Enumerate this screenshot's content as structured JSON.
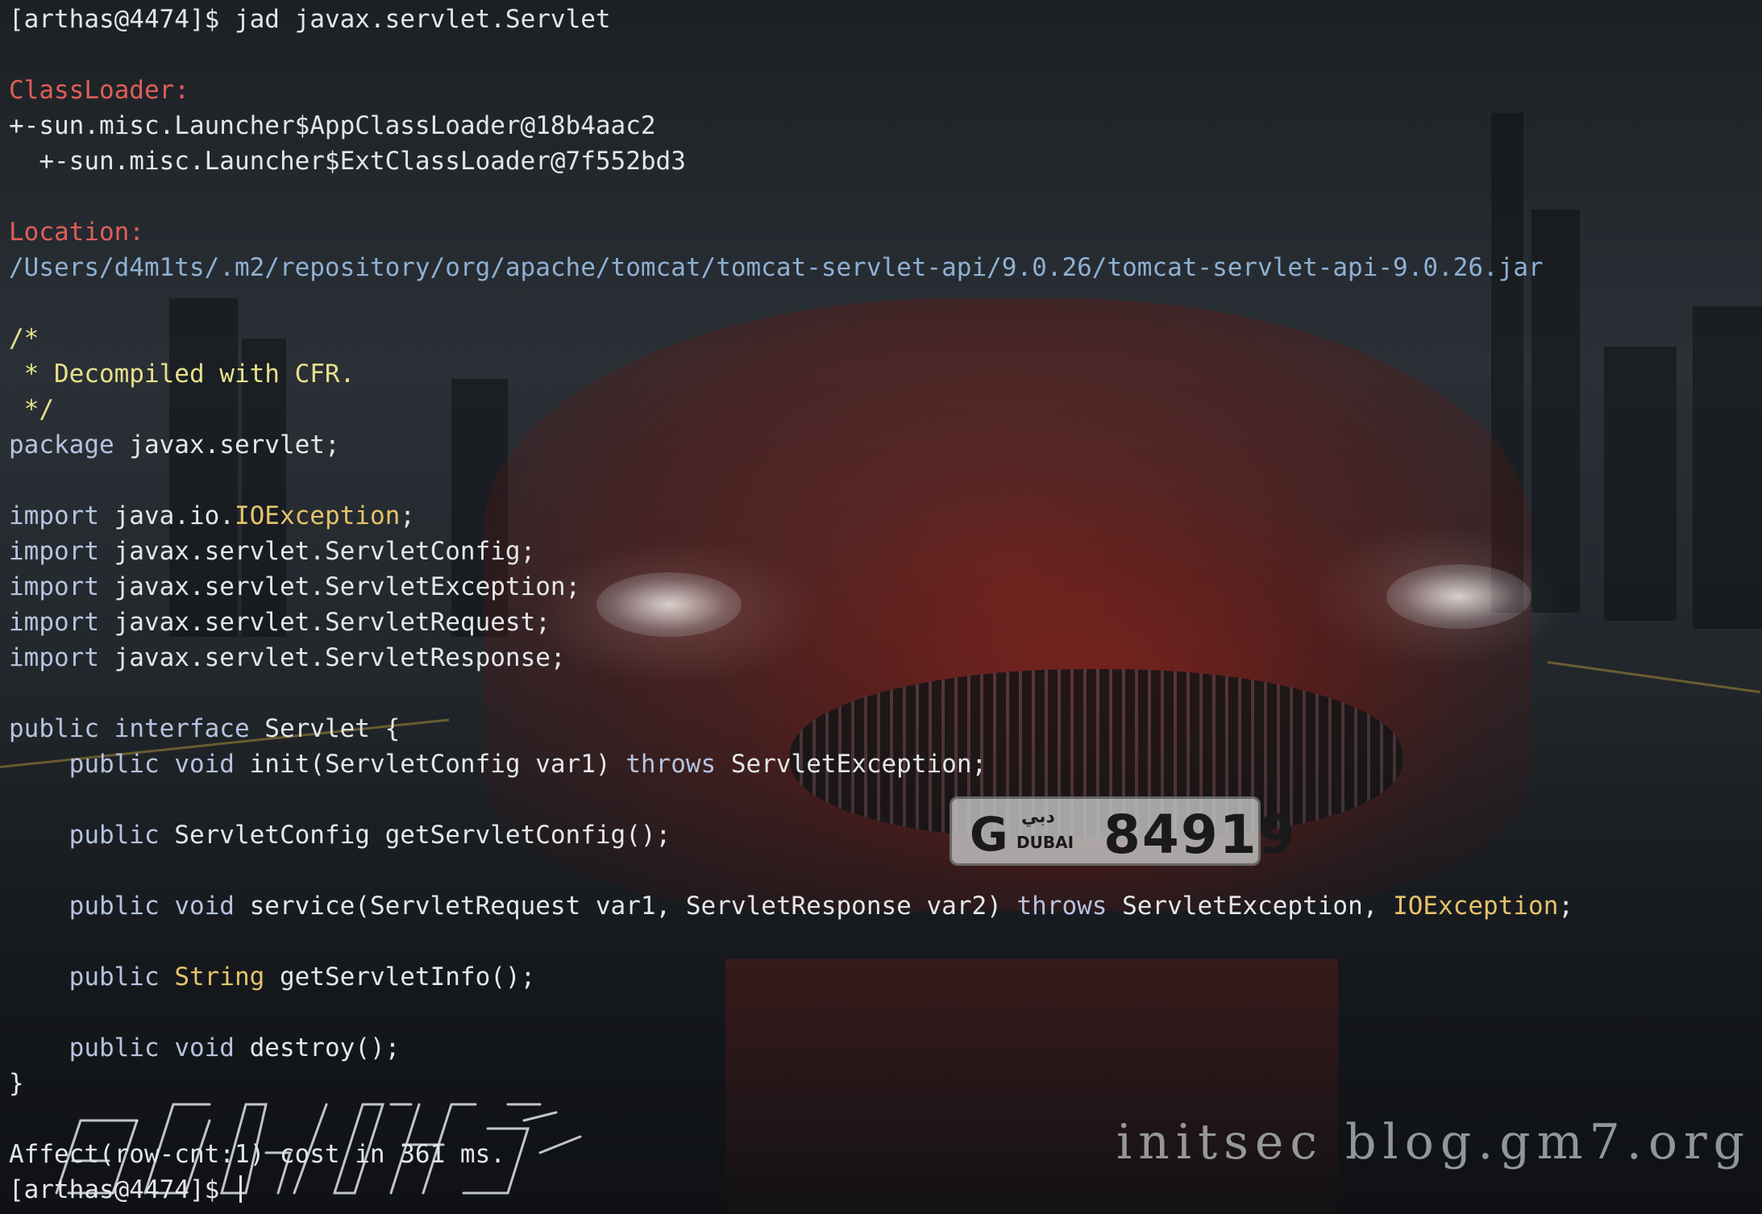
{
  "terminal": {
    "prompt": "[arthas@4474]$ ",
    "command": "jad javax.servlet.Servlet",
    "classloader_header": "ClassLoader:",
    "classloader_1": "+-sun.misc.Launcher$AppClassLoader@18b4aac2",
    "classloader_2": "  +-sun.misc.Launcher$ExtClassLoader@7f552bd3",
    "location_header": "Location:",
    "location_path": "/Users/d4m1ts/.m2/repository/org/apache/tomcat/tomcat-servlet-api/9.0.26/tomcat-servlet-api-9.0.26.jar",
    "code": {
      "comment_open": "/*",
      "comment_body": " * Decompiled with CFR.",
      "comment_close": " */",
      "kw_package": "package",
      "package_name": " javax.servlet;",
      "kw_import": "import",
      "import_1_prefix": " java.io.",
      "import_1_class": "IOException",
      "import_1_suffix": ";",
      "import_2": " javax.servlet.ServletConfig;",
      "import_3": " javax.servlet.ServletException;",
      "import_4": " javax.servlet.ServletRequest;",
      "import_5": " javax.servlet.ServletResponse;",
      "kw_public": "public",
      "kw_interface": "interface",
      "kw_void": "void",
      "kw_throws": "throws",
      "type_string": "String",
      "type_ioexception": "IOException",
      "interface_name": " Servlet {",
      "m1_sig": " init(ServletConfig var1) ",
      "m1_exc": " ServletException;",
      "m2_sig": " ServletConfig getServletConfig();",
      "m3_sig": " service(ServletRequest var1, ServletResponse var2) ",
      "m3_exc": " ServletException, ",
      "m3_end": ";",
      "m4_sig": " getServletInfo();",
      "m5_sig": " destroy();",
      "close_brace": "}"
    },
    "affect_line": "Affect(row-cnt:1) cost in 361 ms.",
    "final_prompt": "[arthas@4474]$ "
  },
  "watermark": "initsec blog.gm7.org",
  "wallpaper": {
    "plate_letter": "G",
    "plate_arabic": "دبي",
    "plate_city": "DUBAI",
    "plate_number": "84919"
  },
  "colors": {
    "header_red": "#e05e58",
    "path_blue": "#8fb0d3",
    "comment_yellow": "#e7e08a",
    "keyword_blue": "#b6c3df",
    "type_orange": "#e6c36a",
    "text": "#e4e6e8"
  },
  "icons": {
    "logo": "arthas-logo-ascii"
  }
}
